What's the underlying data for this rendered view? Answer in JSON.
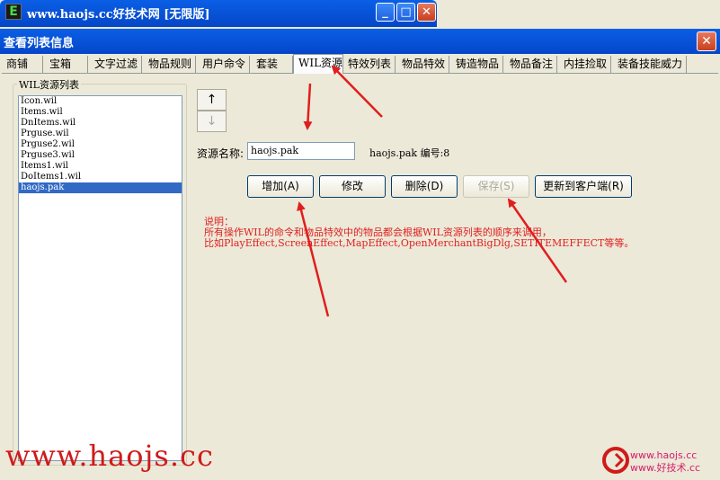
{
  "background_window": {
    "title": "www.haojs.cc好技术网 [无限版]",
    "app_icon": "E",
    "buttons": {
      "minimize": "_",
      "maximize": "□",
      "close": "✕"
    }
  },
  "dialog": {
    "title": "查看列表信息",
    "close_glyph": "✕"
  },
  "tabs": [
    {
      "label": "商铺"
    },
    {
      "label": "宝箱"
    },
    {
      "label": "文字过滤"
    },
    {
      "label": "物品规则"
    },
    {
      "label": "用户命令"
    },
    {
      "label": "套装"
    },
    {
      "label": "WIL资源",
      "active": true
    },
    {
      "label": "特效列表"
    },
    {
      "label": "物品特效"
    },
    {
      "label": "铸造物品"
    },
    {
      "label": "物品备注"
    },
    {
      "label": "内挂捡取"
    },
    {
      "label": "装备技能威力"
    }
  ],
  "resource_list": {
    "group_label": "WIL资源列表",
    "items": [
      "Icon.wil",
      "Items.wil",
      "DnItems.wil",
      "Prguse.wil",
      "Prguse2.wil",
      "Prguse3.wil",
      "Items1.wil",
      "DoItems1.wil",
      "haojs.pak"
    ],
    "selected_index": 8
  },
  "order_buttons": {
    "up": "↑",
    "down": "↓"
  },
  "resource_name": {
    "label": "资源名称:",
    "value": "haojs.pak",
    "info": "haojs.pak 编号:8"
  },
  "actions": {
    "add": "增加(A)",
    "modify": "修改",
    "delete": "删除(D)",
    "save": "保存(S)",
    "update_client": "更新到客户端(R)"
  },
  "note": {
    "line1": "说明：",
    "line2": "所有操作WIL的命令和物品特效中的物品都会根据WIL资源列表的顺序来调用，",
    "line3": "比如PlayEffect,ScreenEffect,MapEffect,OpenMerchantBigDlg,SETITEMEFFECT等等。"
  },
  "watermark": {
    "left": "www.haojs.cc",
    "right_line1": "www.haojs.cc",
    "right_line2": "www.好技术.cc"
  },
  "colors": {
    "titlebar": "#0a5fe6",
    "selection": "#316ac5",
    "note_text": "#e02020",
    "arrow": "#e01e1e"
  }
}
